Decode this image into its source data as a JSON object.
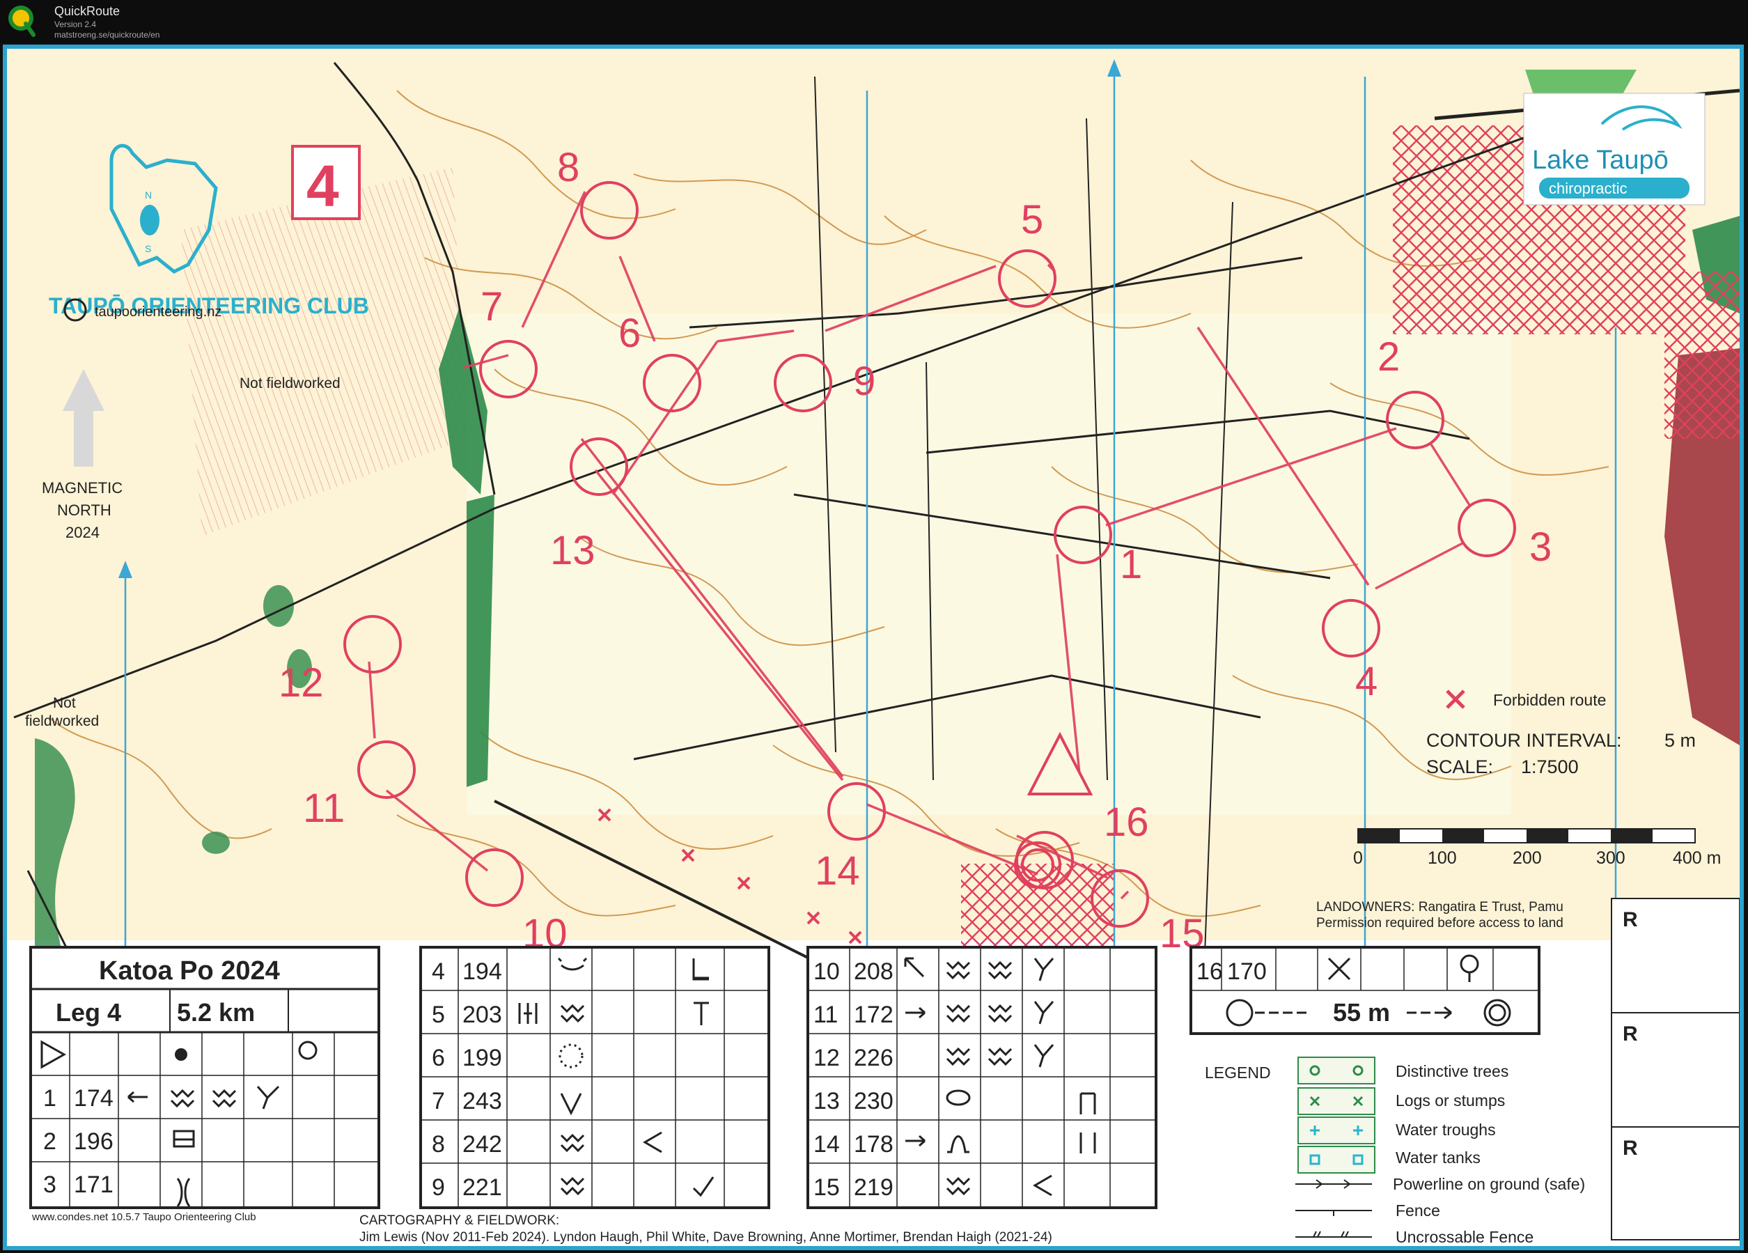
{
  "app": {
    "name": "QuickRoute",
    "version": "Version 2.4",
    "url": "matstroeng.se/quickroute/en"
  },
  "colors": {
    "frame": "#2aa3cf",
    "course": "#e0405f",
    "contour": "#c98a3a",
    "vegetation": "#2e8b4a",
    "north": "#3aa7d6",
    "water": "#2ab4cc"
  },
  "map": {
    "club_name": "TAUPŌ ORIENTEERING CLUB",
    "logo_letters": {
      "n": "N",
      "s": "S"
    },
    "website": "taupoorienteering.nz",
    "sponsor_line1": "Lake Taupō",
    "sponsor_line2": "chiropractic",
    "course_number": "4",
    "not_fieldworked_top": "Not fieldworked",
    "not_fieldworked_left": [
      "Not",
      "fieldworked"
    ],
    "magnetic_north": [
      "MAGNETIC",
      "NORTH",
      "2024"
    ],
    "forbidden_route": "Forbidden route",
    "contour_interval_label": "CONTOUR INTERVAL:",
    "contour_interval_value": "5 m",
    "scale_label": "SCALE:",
    "scale_value": "1:7500",
    "scale_ticks": [
      "0",
      "100",
      "200",
      "300",
      "400 m"
    ],
    "landowners": "LANDOWNERS:  Rangatira E Trust, Pamu",
    "permission": "Permission required before access to land",
    "cartography_title": "CARTOGRAPHY & FIELDWORK:",
    "cartography_credits": "Jim Lewis (Nov 2011-Feb 2024).    Lyndon Haugh, Phil White, Dave Browning, Anne Mortimer, Brendan Haigh (2021-24)",
    "software": "www.condes.net 10.5.7 Taupo Orienteering Club",
    "control_labels": [
      "1",
      "2",
      "3",
      "4",
      "5",
      "6",
      "7",
      "8",
      "9",
      "10",
      "11",
      "12",
      "13",
      "14",
      "15",
      "16"
    ]
  },
  "legend": {
    "title": "LEGEND",
    "items": [
      "Distinctive trees",
      "Logs or stumps",
      "Water troughs",
      "Water tanks",
      "Powerline on ground (safe)",
      "Fence",
      "Uncrossable Fence"
    ]
  },
  "descriptions": {
    "event": "Katoa Po 2024",
    "leg": "Leg 4",
    "distance": "5.2 km",
    "rows": [
      {
        "n": "1",
        "code": "174"
      },
      {
        "n": "2",
        "code": "196"
      },
      {
        "n": "3",
        "code": "171"
      },
      {
        "n": "4",
        "code": "194"
      },
      {
        "n": "5",
        "code": "203"
      },
      {
        "n": "6",
        "code": "199"
      },
      {
        "n": "7",
        "code": "243"
      },
      {
        "n": "8",
        "code": "242"
      },
      {
        "n": "9",
        "code": "221"
      },
      {
        "n": "10",
        "code": "208"
      },
      {
        "n": "11",
        "code": "172"
      },
      {
        "n": "12",
        "code": "226"
      },
      {
        "n": "13",
        "code": "230"
      },
      {
        "n": "14",
        "code": "178"
      },
      {
        "n": "15",
        "code": "219"
      },
      {
        "n": "16",
        "code": "170"
      }
    ],
    "finish_distance": "55 m",
    "r_marks": [
      "R",
      "R",
      "R"
    ]
  }
}
